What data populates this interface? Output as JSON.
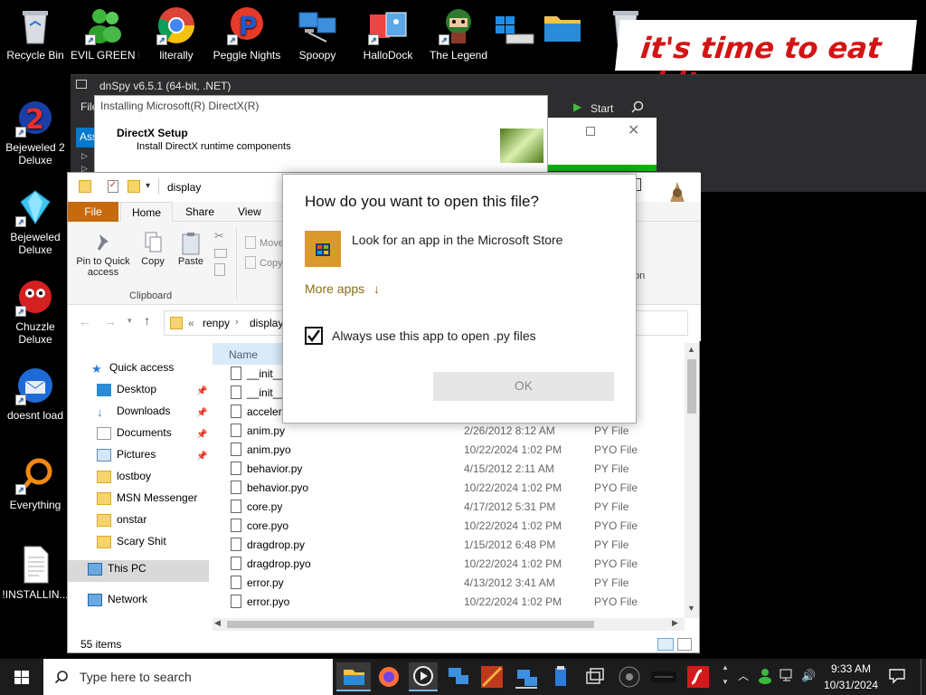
{
  "desktop": {
    "icons": [
      {
        "label": "Recycle Bin"
      },
      {
        "label": "EVIL GREEN MSN SO..."
      },
      {
        "label": "literally"
      },
      {
        "label": "Peggle Nights"
      },
      {
        "label": "Spoopy"
      },
      {
        "label": "HalloDock"
      },
      {
        "label": "The Legend"
      },
      {
        "label": "Bejeweled 2 Deluxe"
      },
      {
        "label": "Bejeweled Deluxe"
      },
      {
        "label": "Chuzzle Deluxe"
      },
      {
        "label": "doesnt load"
      },
      {
        "label": "Everything"
      },
      {
        "label": "!INSTALLIN..."
      }
    ],
    "banner_text": "it's time to eat shit"
  },
  "dnspy": {
    "title": "dnSpy v6.5.1 (64-bit, .NET)",
    "menu_file": "File",
    "start_label": "Start",
    "assembly_tab": "Ass"
  },
  "directx": {
    "window_title": "Installing Microsoft(R) DirectX(R)",
    "heading": "DirectX Setup",
    "subheading": "Install DirectX runtime components"
  },
  "explorer": {
    "title": "display",
    "tabs": [
      "File",
      "Home",
      "Share",
      "View"
    ],
    "ribbon": {
      "pin_label": "Pin to Quick access",
      "copy_label": "Copy",
      "paste_label": "Paste",
      "move_label": "Move",
      "copy_to_label": "Copy",
      "group_label": "Clipboard",
      "partial_on": "on"
    },
    "address": {
      "prefix": "«",
      "crumb1": "renpy",
      "crumb2": "display"
    },
    "column_name": "Name",
    "nav": {
      "quick_access": "Quick access",
      "items": [
        "Desktop",
        "Downloads",
        "Documents",
        "Pictures",
        "lostboy",
        "MSN Messenger",
        "onstar",
        "Scary Shit"
      ],
      "this_pc": "This PC",
      "network": "Network"
    },
    "files": [
      {
        "name": "__init__.py",
        "date": "",
        "type": ""
      },
      {
        "name": "__init__.pyo",
        "date": "",
        "type": ""
      },
      {
        "name": "accelerator.py",
        "date": "",
        "type": ""
      },
      {
        "name": "anim.py",
        "date": "2/26/2012 8:12 AM",
        "type": "PY File"
      },
      {
        "name": "anim.pyo",
        "date": "10/22/2024 1:02 PM",
        "type": "PYO File"
      },
      {
        "name": "behavior.py",
        "date": "4/15/2012 2:11 AM",
        "type": "PY File"
      },
      {
        "name": "behavior.pyo",
        "date": "10/22/2024 1:02 PM",
        "type": "PYO File"
      },
      {
        "name": "core.py",
        "date": "4/17/2012 5:31 PM",
        "type": "PY File"
      },
      {
        "name": "core.pyo",
        "date": "10/22/2024 1:02 PM",
        "type": "PYO File"
      },
      {
        "name": "dragdrop.py",
        "date": "1/15/2012 6:48 PM",
        "type": "PY File"
      },
      {
        "name": "dragdrop.pyo",
        "date": "10/22/2024 1:02 PM",
        "type": "PYO File"
      },
      {
        "name": "error.py",
        "date": "4/13/2012 3:41 AM",
        "type": "PY File"
      },
      {
        "name": "error.pyo",
        "date": "10/22/2024 1:02 PM",
        "type": "PYO File"
      }
    ],
    "status": "55 items"
  },
  "dialog": {
    "title": "How do you want to open this file?",
    "store_option": "Look for an app in the Microsoft Store",
    "more_apps": "More apps",
    "more_apps_arrow": "↓",
    "always_use": "Always use this app to open .py files",
    "always_checked": true,
    "ok_label": "OK"
  },
  "taskbar": {
    "search_placeholder": "Type here to search",
    "time": "9:33 AM",
    "date": "10/31/2024"
  }
}
